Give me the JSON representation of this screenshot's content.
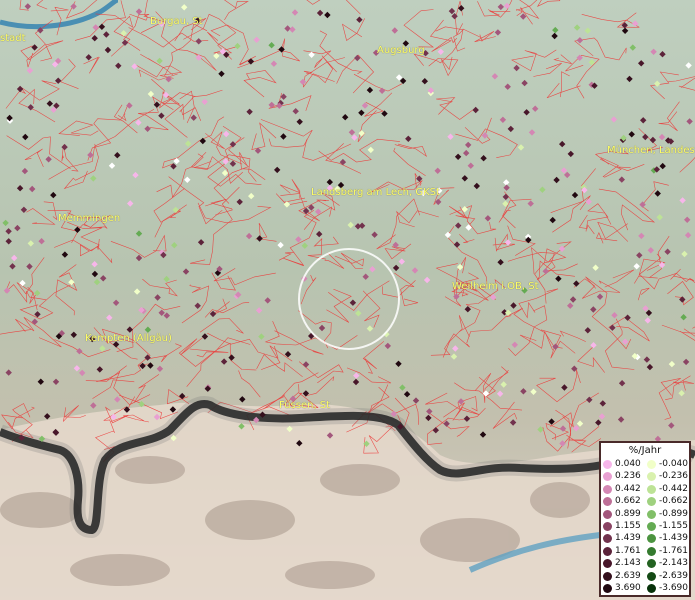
{
  "map": {
    "cities": [
      {
        "name": "stadt"
      },
      {
        "name": "Burgau, St"
      },
      {
        "name": "Augsburg"
      },
      {
        "name": "München, Landes"
      },
      {
        "name": "Landsberg am Lech, GKSt"
      },
      {
        "name": "Memmingen"
      },
      {
        "name": "Weilheim i.OB, St"
      },
      {
        "name": "Kempten (Allgäu)"
      },
      {
        "name": "Füssen, St"
      }
    ]
  },
  "legend": {
    "title": "%/Jahr",
    "positive": [
      "0.040",
      "0.236",
      "0.442",
      "0.662",
      "0.899",
      "1.155",
      "1.439",
      "1.761",
      "2.143",
      "2.639",
      "3.690"
    ],
    "negative": [
      "-0.040",
      "-0.236",
      "-0.442",
      "-0.662",
      "-0.899",
      "-1.155",
      "-1.439",
      "-1.761",
      "-2.143",
      "-2.639",
      "-3.690"
    ],
    "positive_colors": [
      "#f7b6ea",
      "#e9a0d2",
      "#d487b4",
      "#be6f97",
      "#a3577c",
      "#8a4463",
      "#72324d",
      "#5c233a",
      "#48172a",
      "#34101d",
      "#200810"
    ],
    "negative_colors": [
      "#f1ffc8",
      "#d9f1ae",
      "#bde396",
      "#9fd17f",
      "#81bf68",
      "#64ab53",
      "#4c9440",
      "#357b2f",
      "#236221",
      "#144a15",
      "#07320a"
    ]
  }
}
